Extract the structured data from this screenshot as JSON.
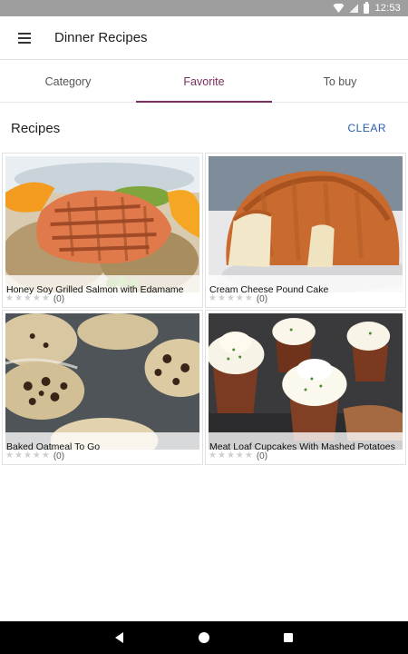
{
  "status_bar": {
    "time": "12:53",
    "icons": [
      "wifi-icon",
      "signal-icon",
      "battery-icon"
    ]
  },
  "app_bar": {
    "title": "Dinner Recipes",
    "menu_icon": "hamburger-menu-icon"
  },
  "tabs": [
    {
      "label": "Category",
      "active": false
    },
    {
      "label": "Favorite",
      "active": true
    },
    {
      "label": "To buy",
      "active": false
    }
  ],
  "section": {
    "title": "Recipes",
    "clear_label": "CLEAR"
  },
  "recipes": [
    {
      "name": "Honey Soy Grilled Salmon with Edamame",
      "rating_count": "(0)"
    },
    {
      "name": "Cream Cheese Pound Cake",
      "rating_count": "(0)"
    },
    {
      "name": "Baked Oatmeal To Go",
      "rating_count": "(0)"
    },
    {
      "name": "Meat Loaf Cupcakes With Mashed Potatoes",
      "rating_count": "(0)"
    }
  ],
  "colors": {
    "accent": "#7b2d5f",
    "clear_button": "#2a5db0",
    "status_bar": "#9e9e9e"
  },
  "nav_bar": {
    "buttons": [
      "back-icon",
      "home-icon",
      "recents-icon"
    ]
  }
}
